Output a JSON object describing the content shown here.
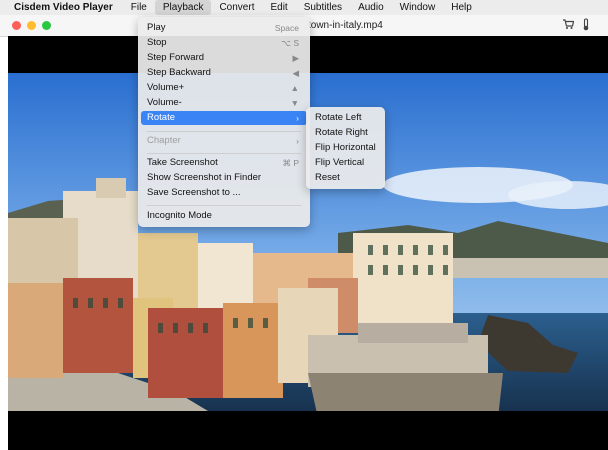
{
  "menubar": {
    "app_name": "Cisdem Video Player",
    "items": [
      "File",
      "Playback",
      "Convert",
      "Edit",
      "Subtitles",
      "Audio",
      "Window",
      "Help"
    ],
    "active": "Playback"
  },
  "window": {
    "title": "town-in-italy.mp4",
    "icons": [
      "cart-icon",
      "thermometer-icon"
    ]
  },
  "playback_menu": {
    "items": [
      {
        "label": "Play",
        "shortcut": "Space"
      },
      {
        "label": "Stop",
        "shortcut": "⌥ S"
      },
      {
        "label": "Step Forward",
        "shortcut": "▶"
      },
      {
        "label": "Step Backward",
        "shortcut": "◀"
      },
      {
        "label": "Volume+",
        "shortcut": "▲"
      },
      {
        "label": "Volume-",
        "shortcut": "▼"
      },
      {
        "label": "Rotate",
        "shortcut": "›",
        "highlighted": true
      },
      {
        "label": "Chapter",
        "shortcut": "›",
        "disabled": true
      },
      {
        "label": "Take Screenshot",
        "shortcut": "⌘ P"
      },
      {
        "label": "Show Screenshot in Finder",
        "shortcut": ""
      },
      {
        "label": "Save Screenshot to ...",
        "shortcut": ""
      },
      {
        "label": "Incognito Mode",
        "shortcut": ""
      }
    ]
  },
  "rotate_submenu": {
    "items": [
      "Rotate Left",
      "Rotate Right",
      "Flip Horizontal",
      "Flip Vertical",
      "Reset"
    ]
  },
  "colors": {
    "highlight": "#3b84f6",
    "menubar_bg": "#ececec",
    "video_bg": "#000000"
  }
}
